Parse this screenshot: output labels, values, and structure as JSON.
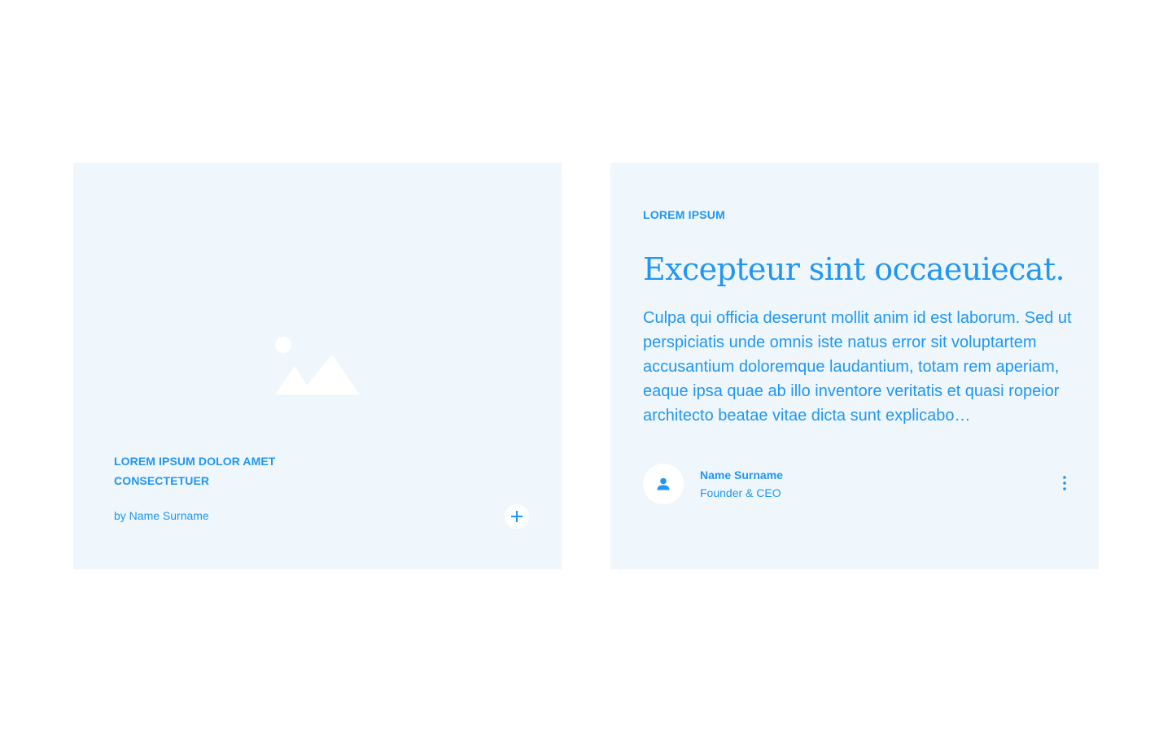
{
  "colors": {
    "accent": "#2196f3",
    "card_background": "#eff7fd",
    "page_background": "#ffffff"
  },
  "left_card": {
    "image_icon": "image-placeholder-icon",
    "title": "LOREM IPSUM DOLOR AMET CONSECTETUER",
    "byline": "by Name Surname",
    "add_icon": "plus-icon"
  },
  "right_card": {
    "eyebrow": "LOREM IPSUM",
    "headline": "Excepteur sint occaeuiecat.",
    "body": "Culpa qui officia deserunt mollit anim id est laborum. Sed ut perspiciatis unde omnis iste natus error sit voluptartem accusantium doloremque laudantium, totam rem aperiam, eaque ipsa quae ab illo inventore veritatis et quasi ropeior architecto beatae vitae dicta sunt explicabo…",
    "author": {
      "avatar_icon": "person-icon",
      "name": "Name Surname",
      "role": "Founder & CEO"
    },
    "more_icon": "more-vertical-icon"
  }
}
